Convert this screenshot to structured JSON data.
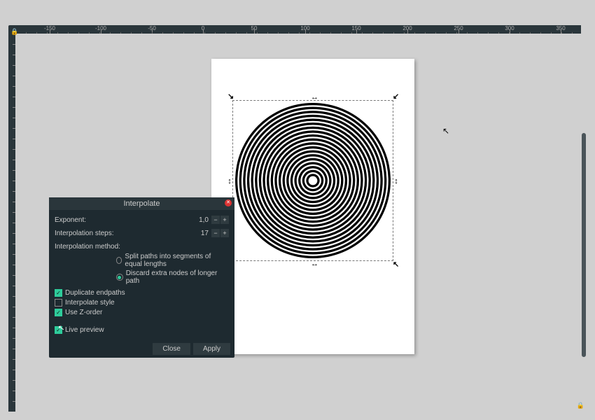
{
  "ruler_ticks": [
    "-150",
    "-100",
    "-50",
    "0",
    "50",
    "100",
    "150",
    "200",
    "250",
    "300",
    "350"
  ],
  "dialog": {
    "title": "Interpolate",
    "exponent_label": "Exponent:",
    "exponent_value": "1,0",
    "steps_label": "Interpolation steps:",
    "steps_value": "17",
    "method_label": "Interpolation method:",
    "method_option1": "Split paths into segments of equal lengths",
    "method_option2": "Discard extra nodes of longer path",
    "duplicate_label": "Duplicate endpaths",
    "interp_style_label": "Interpolate style",
    "zorder_label": "Use Z-order",
    "live_preview_label": "Live preview",
    "close_label": "Close",
    "apply_label": "Apply"
  },
  "checks": {
    "duplicate": true,
    "interp_style": false,
    "zorder": true,
    "live_preview": true
  },
  "method_selected": 1
}
